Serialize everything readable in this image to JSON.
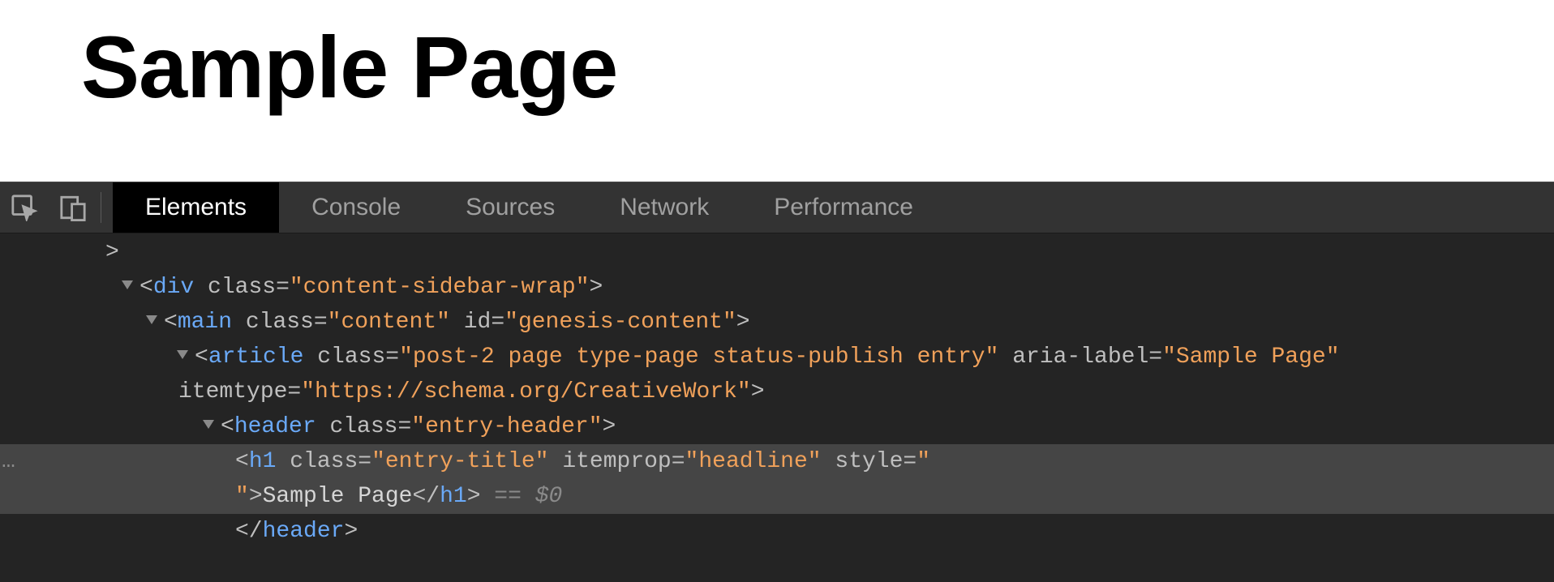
{
  "page": {
    "title": "Sample Page"
  },
  "devtools": {
    "tabs": [
      {
        "label": "Elements",
        "active": true
      },
      {
        "label": "Console"
      },
      {
        "label": "Sources"
      },
      {
        "label": "Network"
      },
      {
        "label": "Performance"
      }
    ]
  },
  "dom": {
    "line0_trail": ">",
    "div": {
      "tag": "div",
      "class_attr": "class",
      "class_val": "\"content-sidebar-wrap\""
    },
    "main": {
      "tag": "main",
      "class_attr": "class",
      "class_val": "\"content\"",
      "id_attr": "id",
      "id_val": "\"genesis-content\""
    },
    "article": {
      "tag": "article",
      "class_attr": "class",
      "class_val": "\"post-2 page type-page status-publish entry\"",
      "aria_attr": "aria-label",
      "aria_val": "\"Sample Page\"",
      "itemtype_attr": "itemtype",
      "itemtype_val": "\"https://schema.org/CreativeWork\""
    },
    "header": {
      "tag": "header",
      "class_attr": "class",
      "class_val": "\"entry-header\"",
      "close": "header"
    },
    "h1": {
      "tag": "h1",
      "class_attr": "class",
      "class_val": "\"entry-title\"",
      "itemprop_attr": "itemprop",
      "itemprop_val": "\"headline\"",
      "style_attr": "style",
      "style_open": "\"",
      "style_close": "\"",
      "text": "Sample Page",
      "close": "h1",
      "sel": " == $0"
    },
    "ellipsis": "…",
    "lt": "<",
    "gt": ">",
    "slash": "</",
    "eq": "=",
    "sp": " "
  }
}
